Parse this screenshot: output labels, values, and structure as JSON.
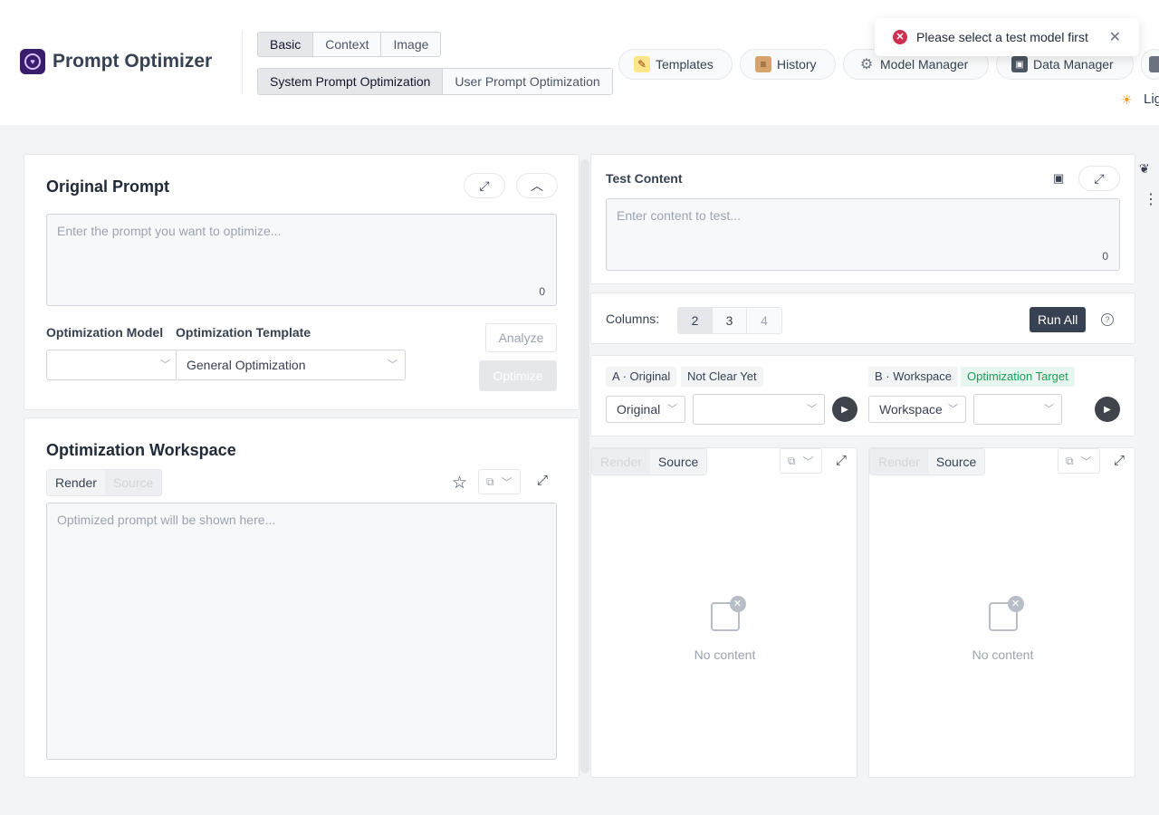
{
  "app": {
    "title": "Prompt Optimizer"
  },
  "mode_tabs": [
    "Basic",
    "Context",
    "Image"
  ],
  "optimization_tabs": [
    "System Prompt Optimization",
    "User Prompt Optimization"
  ],
  "nav": {
    "templates": "Templates",
    "history": "History",
    "model_manager": "Model Manager",
    "data_manager": "Data Manager"
  },
  "toast": {
    "message": "Please select a test model first"
  },
  "theme": {
    "label": "Lig"
  },
  "original_prompt": {
    "title": "Original Prompt",
    "placeholder": "Enter the prompt you want to optimize...",
    "count": "0",
    "model_label": "Optimization Model",
    "template_label": "Optimization Template",
    "template_value": "General Optimization",
    "analyze": "Analyze",
    "optimize": "Optimize"
  },
  "workspace": {
    "title": "Optimization Workspace",
    "render": "Render",
    "source": "Source",
    "placeholder": "Optimized prompt will be shown here..."
  },
  "test_content": {
    "title": "Test Content",
    "placeholder": "Enter content to test...",
    "count": "0"
  },
  "columns": {
    "label": "Columns:",
    "options": [
      "2",
      "3",
      "4"
    ],
    "run_all": "Run All"
  },
  "variants": {
    "a": {
      "tag": "A · Original",
      "status": "Not Clear Yet",
      "select": "Original"
    },
    "b": {
      "tag": "B · Workspace",
      "status": "Optimization Target",
      "select": "Workspace"
    }
  },
  "results": {
    "render": "Render",
    "source": "Source",
    "empty": "No content"
  },
  "colors": {
    "accent": "#374151",
    "error": "#d03050",
    "success": "#18a058"
  }
}
